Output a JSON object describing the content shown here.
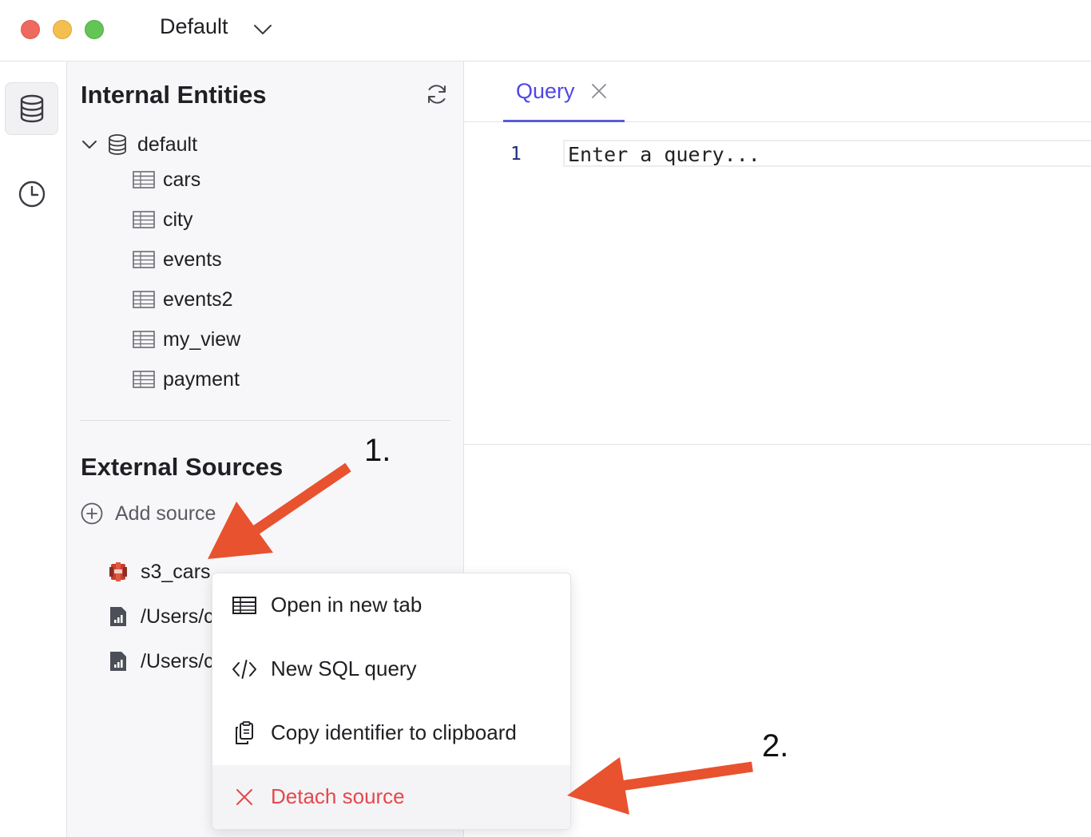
{
  "window": {
    "workspace_name": "Default",
    "traffic_light_colors": {
      "close": "#ee6a5e",
      "minimize": "#f5bf4f",
      "zoom": "#62c555"
    }
  },
  "rail": {
    "items": [
      {
        "icon": "database-icon",
        "active": true
      },
      {
        "icon": "history-clock-icon",
        "active": false
      }
    ]
  },
  "sidebar": {
    "internal_title": "Internal Entities",
    "database": {
      "name": "default",
      "tables": [
        {
          "label": "cars"
        },
        {
          "label": "city"
        },
        {
          "label": "events"
        },
        {
          "label": "events2"
        },
        {
          "label": "my_view"
        },
        {
          "label": "payment"
        }
      ]
    },
    "external_title": "External Sources",
    "add_source_label": "Add source",
    "sources": [
      {
        "label": "s3_cars",
        "icon": "aws-s3-icon"
      },
      {
        "label": "/Users/c",
        "icon": "file-chart-icon"
      },
      {
        "label": "/Users/c",
        "icon": "file-chart-icon"
      }
    ]
  },
  "editor": {
    "tab_label": "Query",
    "line_number": "1",
    "placeholder": "Enter a query..."
  },
  "context_menu": {
    "items": [
      {
        "label": "Open in new tab",
        "icon": "table-icon"
      },
      {
        "label": "New SQL query",
        "icon": "code-icon"
      },
      {
        "label": "Copy identifier to clipboard",
        "icon": "clipboard-copy-icon"
      },
      {
        "label": "Detach source",
        "icon": "close-icon",
        "danger": true
      }
    ]
  },
  "annotations": {
    "step1_label": "1.",
    "step2_label": "2.",
    "arrow_color": "#e8522f"
  },
  "colors": {
    "accent": "#4f46e5",
    "danger": "#e5484d",
    "sidebar_bg": "#f7f7f9"
  }
}
